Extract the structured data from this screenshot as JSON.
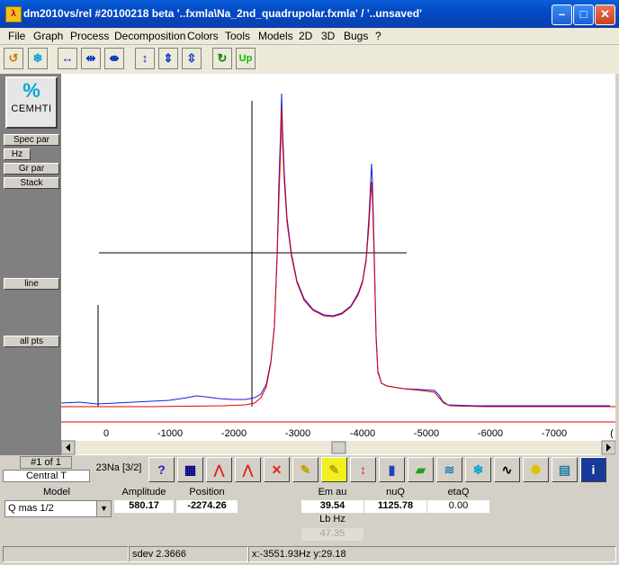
{
  "window": {
    "title": "dm2010vs/rel #20100218 beta '..fxmla\\Na_2nd_quadrupolar.fxmla' / '..unsaved'"
  },
  "menu": [
    "File",
    "Graph",
    "Process",
    "Decomposition",
    "Colors",
    "Tools",
    "Models",
    "2D",
    "3D",
    "Bugs",
    "?"
  ],
  "toolbar": {
    "up_label": "Up"
  },
  "left_panel": {
    "logo_text": "CEMHTI",
    "spec_par": "Spec par",
    "hz": "Hz",
    "gr_par": "Gr par",
    "stack": "Stack",
    "line": "line",
    "all_pts": "all pts"
  },
  "axis": {
    "ticks": [
      "0",
      "-1000",
      "-2000",
      "-3000",
      "-4000",
      "-5000",
      "-6000",
      "-7000",
      "("
    ]
  },
  "bottom": {
    "line_index": "#1 of 1",
    "central": "Central T",
    "nucleus": "23Na [3/2]",
    "model_label": "Model",
    "model_value": "Q mas 1/2",
    "amplitude_label": "Amplitude",
    "amplitude_value": "580.17",
    "position_label": "Position",
    "position_value": "-2274.26",
    "em_label": "Em au",
    "em_value": "39.54",
    "nuq_label": "nuQ",
    "nuq_value": "1125.78",
    "etaq_label": "etaQ",
    "etaq_value": "0.00",
    "lb_label": "Lb Hz",
    "lb_value": "47.35"
  },
  "status": {
    "sdev": "sdev 2.3666",
    "coords": "x:-3551.93Hz y:29.18"
  },
  "colors": {
    "exp": "#1a1ae0",
    "fit": "#e00000",
    "titlebar": "#0a4fc8"
  }
}
